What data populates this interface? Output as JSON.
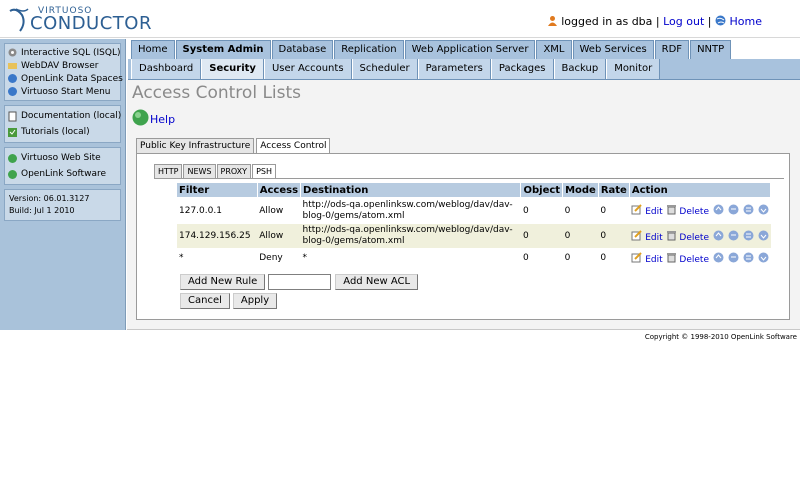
{
  "logo": {
    "sub": "VIRTUOSO",
    "main": "CONDUCTOR"
  },
  "userbar": {
    "logged_in": "logged in as dba",
    "separator": "|",
    "logout": "Log out",
    "home": "Home"
  },
  "sidebar": {
    "group1": [
      "Interactive SQL (ISQL)",
      "WebDAV Browser",
      "OpenLink Data Spaces",
      "Virtuoso Start Menu"
    ],
    "group2": [
      "Documentation (local)",
      "Tutorials (local)"
    ],
    "group3": [
      "Virtuoso Web Site",
      "OpenLink Software"
    ],
    "version": "Version: 06.01.3127",
    "build": "Build: Jul 1 2010"
  },
  "tabs_main": [
    "Home",
    "System Admin",
    "Database",
    "Replication",
    "Web Application Server",
    "XML",
    "Web Services",
    "RDF",
    "NNTP"
  ],
  "tabs_sub": [
    "Dashboard",
    "Security",
    "User Accounts",
    "Scheduler",
    "Parameters",
    "Packages",
    "Backup",
    "Monitor"
  ],
  "page": {
    "title": "Access Control Lists",
    "help": "Help"
  },
  "outer_tabs": [
    "Public Key Infrastructure",
    "Access Control"
  ],
  "inner_tabs": [
    "HTTP",
    "NEWS",
    "PROXY",
    "PSH"
  ],
  "table": {
    "headers": [
      "Filter",
      "Access",
      "Destination",
      "Object",
      "Mode",
      "Rate",
      "Action"
    ],
    "rows": [
      {
        "filter": "127.0.0.1",
        "access": "Allow",
        "dest": "http://ods-qa.openlinksw.com/weblog/dav/dav-blog-0/gems/atom.xml",
        "object": "0",
        "mode": "0",
        "rate": "0"
      },
      {
        "filter": "174.129.156.25",
        "access": "Allow",
        "dest": "http://ods-qa.openlinksw.com/weblog/dav/dav-blog-0/gems/atom.xml",
        "object": "0",
        "mode": "0",
        "rate": "0"
      },
      {
        "filter": "*",
        "access": "Deny",
        "dest": "*",
        "object": "0",
        "mode": "0",
        "rate": "0"
      }
    ],
    "edit_label": "Edit",
    "delete_label": "Delete"
  },
  "buttons": {
    "add_rule": "Add New Rule",
    "add_acl": "Add New ACL",
    "cancel": "Cancel",
    "apply": "Apply"
  },
  "inputs": {
    "rule_value": ""
  },
  "footer": "Copyright © 1998-2010 OpenLink Software",
  "colors": {
    "brand": "#2d5f93",
    "tab": "#a8c2dd",
    "sidebar": "#a9c2da",
    "header_cell": "#b7cbe0",
    "row_alt": "#f0f0dc",
    "link": "#0000cc"
  }
}
